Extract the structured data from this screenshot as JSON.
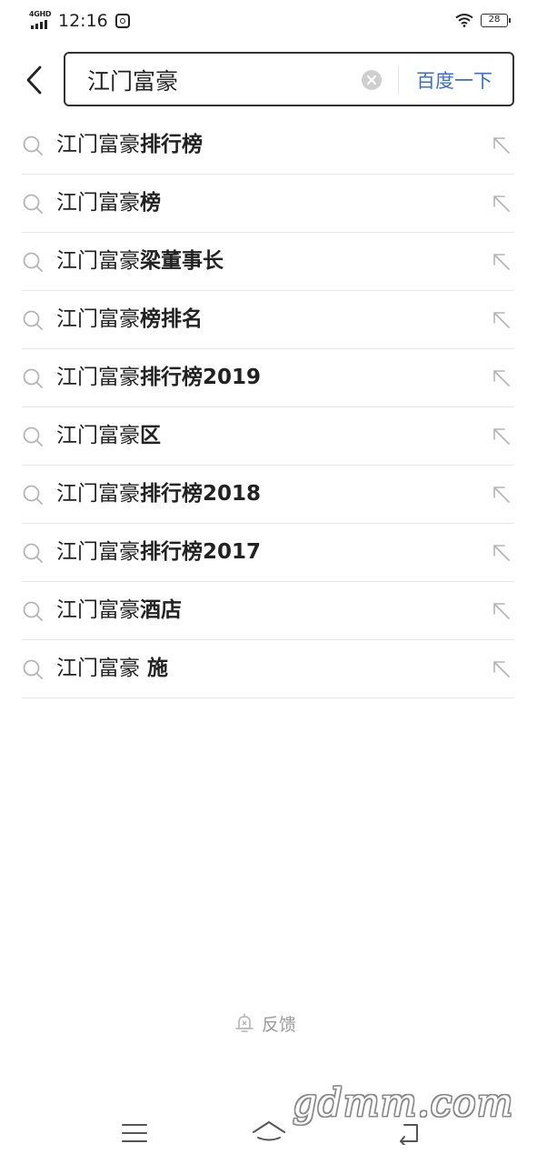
{
  "status_bar": {
    "network_label": "4GHD",
    "time": "12:16",
    "battery_level": "28"
  },
  "search": {
    "query": "江门富豪",
    "placeholder": "",
    "submit_label": "百度一下"
  },
  "suggestions": [
    {
      "prefix": "江门富豪",
      "suffix": "排行榜"
    },
    {
      "prefix": "江门富豪",
      "suffix": "榜"
    },
    {
      "prefix": "江门富豪",
      "suffix": "梁董事长"
    },
    {
      "prefix": "江门富豪",
      "suffix": "榜排名"
    },
    {
      "prefix": "江门富豪",
      "suffix": "排行榜2019"
    },
    {
      "prefix": "江门富豪",
      "suffix": "区"
    },
    {
      "prefix": "江门富豪",
      "suffix": "排行榜2018"
    },
    {
      "prefix": "江门富豪",
      "suffix": "排行榜2017"
    },
    {
      "prefix": "江门富豪",
      "suffix": "酒店"
    },
    {
      "prefix": "江门富豪",
      "suffix": " 施"
    }
  ],
  "feedback": {
    "label": "反馈"
  },
  "watermark": "gdmm.com",
  "colors": {
    "accent": "#3a6fc8",
    "text": "#222222",
    "muted": "#9a9a9a",
    "divider": "#e8e8e8"
  },
  "icons": {
    "suggestion": "search-icon",
    "fill": "arrow-up-left-icon",
    "back": "chevron-left-icon",
    "clear": "close-circle-icon",
    "feedback": "feedback-bell-icon",
    "nav": [
      "menu-icon",
      "home-icon",
      "back-return-icon"
    ]
  }
}
